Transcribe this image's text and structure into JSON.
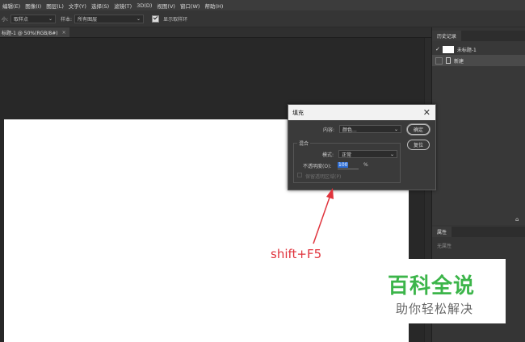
{
  "menu": {
    "items": [
      "编辑(E)",
      "图像(I)",
      "图层(L)",
      "文字(Y)",
      "选择(S)",
      "滤镜(T)",
      "3D(D)",
      "视图(V)",
      "窗口(W)",
      "帮助(H)"
    ]
  },
  "options": {
    "size_label": "小:",
    "size_value": "取样点",
    "sample_label": "样本:",
    "sample_value": "所有图层",
    "show_ring_label": "显示取样环"
  },
  "tabs": {
    "document": "标题-1 @ 50%(RGB/8#)",
    "close": "×"
  },
  "history_panel": {
    "tab": "历史记录",
    "snapshot": "未标题-1",
    "step": "新建"
  },
  "properties_panel": {
    "tab": "属性",
    "empty": "无属性"
  },
  "dialog": {
    "title": "填充",
    "close": "✕",
    "contents_label": "内容:",
    "contents_value": "颜色...",
    "ok": "确定",
    "reset": "复位",
    "blend_legend": "混合",
    "mode_label": "模式:",
    "mode_value": "正常",
    "opacity_label": "不透明度(O):",
    "opacity_value": "100",
    "opacity_unit": "%",
    "preserve_label": "保留透明区域(P)"
  },
  "annotation": {
    "text": "shift+F5",
    "color": "#e0343d"
  },
  "watermark": {
    "title": "百科全说",
    "subtitle": "助你轻松解决",
    "title_color": "#3cb54a"
  }
}
